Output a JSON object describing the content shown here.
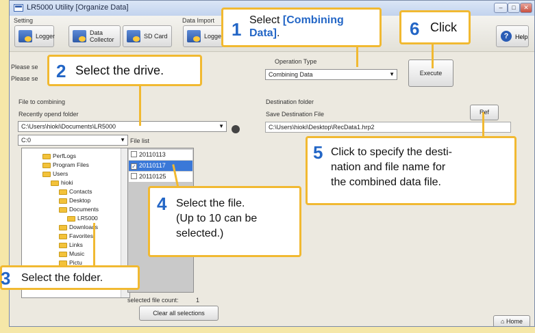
{
  "window": {
    "title": "LR5000 Utility [Organize Data]",
    "controls": [
      "–",
      "□",
      "✕"
    ]
  },
  "toolbar": {
    "setting_label": "Setting",
    "data_import_label": "Data Import",
    "logger": "Logger",
    "data_collector": "Data\nCollector",
    "sd_card": "SD Card",
    "logger2": "Logger",
    "help": "Help"
  },
  "main": {
    "please_sel_1": "Please se",
    "please_sel_2": "Please se",
    "operation_type_label": "Operation Type",
    "operation_type_value": "Combining Data",
    "execute": "Execute",
    "file_to_combining": "File to combining",
    "recent_folder_label": "Recently opend folder",
    "recent_folder_value": "C:\\Users\\hioki\\Documents\\LR5000",
    "drive_value": "C:0",
    "file_list_label": "File list",
    "destination_folder_label": "Destination folder",
    "save_dest_label": "Save Destination File",
    "ref": "Ref",
    "dest_path": "C:\\Users\\hioki\\Desktop\\RecData1.hrp2",
    "selected_count_label": "selected file count:",
    "selected_count_value": "1",
    "clear_all": "Clear all selections",
    "home": "Home"
  },
  "tree": [
    {
      "label": "PerfLogs",
      "level": 2
    },
    {
      "label": "Program Files",
      "level": 2
    },
    {
      "label": "Users",
      "level": 2
    },
    {
      "label": "hioki",
      "level": 3
    },
    {
      "label": "Contacts",
      "level": 4
    },
    {
      "label": "Desktop",
      "level": 4
    },
    {
      "label": "Documents",
      "level": 4
    },
    {
      "label": "LR5000",
      "level": 5
    },
    {
      "label": "Downloads",
      "level": 4
    },
    {
      "label": "Favorites",
      "level": 4
    },
    {
      "label": "Links",
      "level": 4
    },
    {
      "label": "Music",
      "level": 4
    },
    {
      "label": "Pictu",
      "level": 4
    }
  ],
  "files": [
    {
      "name": "20110113",
      "checked": false
    },
    {
      "name": "20110117",
      "checked": true
    },
    {
      "name": "20110125",
      "checked": false
    }
  ],
  "callouts": {
    "c1_num": "1",
    "c1_text_a": "Select ",
    "c1_text_b": "[Combining",
    "c1_text_c": "Data]",
    "c1_text_d": ".",
    "c2_num": "2",
    "c2_text": "Select the drive.",
    "c3_num": "3",
    "c3_text": "Select the folder.",
    "c4_num": "4",
    "c4_line1": "Select the file.",
    "c4_line2": "(Up to 10 can be",
    "c4_line3": "selected.)",
    "c5_num": "5",
    "c5_line1": "Click to specify the desti-",
    "c5_line2": "nation and file name for",
    "c5_line3": "the combined data file.",
    "c6_num": "6",
    "c6_text": "Click"
  },
  "colors": {
    "callout_border": "#f1b931",
    "callout_number": "#2366c6",
    "page_background": "#f5e7a8"
  }
}
